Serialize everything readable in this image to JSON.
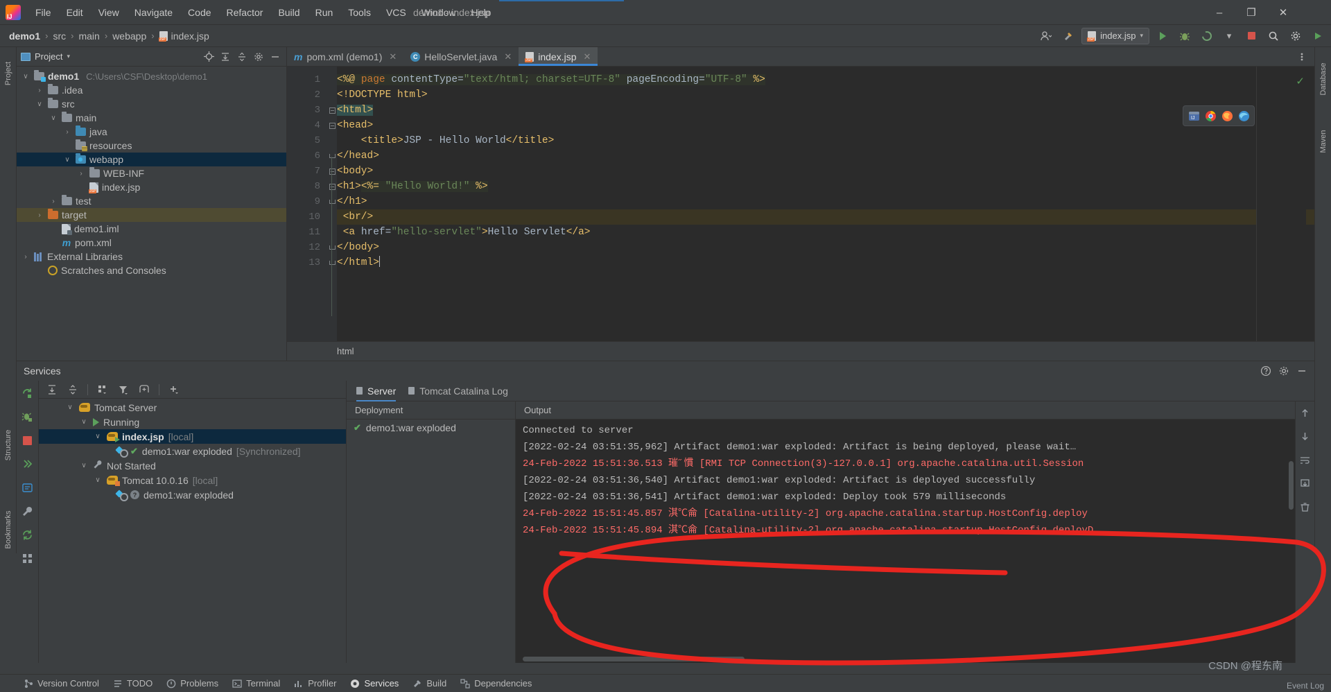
{
  "window": {
    "title": "demo1 - index.jsp",
    "logo": "intellij-idea-logo",
    "minimize": "–",
    "maximize": "❐",
    "close": "✕"
  },
  "menubar": {
    "items": [
      "File",
      "Edit",
      "View",
      "Navigate",
      "Code",
      "Refactor",
      "Build",
      "Run",
      "Tools",
      "VCS",
      "Window",
      "Help"
    ]
  },
  "navbar": {
    "breadcrumbs": [
      "demo1",
      "src",
      "main",
      "webapp",
      "index.jsp"
    ],
    "separator": "›",
    "run_config": "index.jsp",
    "run_config_caret": "▾",
    "buttons": {
      "account": "account-icon",
      "hammer": "build-icon",
      "run": "run-icon",
      "debug": "debug-icon",
      "run_with_coverage": "coverage-icon",
      "more": "▾",
      "stop": "stop-icon",
      "search": "⌕",
      "settings": "⚙",
      "updates": "updates-icon"
    }
  },
  "left_strip": {
    "labels": [
      "Project",
      "Structure",
      "Bookmarks"
    ]
  },
  "right_strip": {
    "labels": [
      "Database",
      "Maven"
    ]
  },
  "project_panel": {
    "title": "Project",
    "caret": "▾",
    "toolbar": [
      "locate-icon",
      "expand-all-icon",
      "collapse-all-icon",
      "settings-icon",
      "hide-icon"
    ],
    "more_icon": "⋮",
    "tree": [
      {
        "label": "demo1",
        "path": "C:\\Users\\CSF\\Desktop\\demo1",
        "indent": 0,
        "arrow": "∨",
        "icon": "module-folder",
        "bold": true,
        "state": "normal"
      },
      {
        "label": ".idea",
        "path": "",
        "indent": 1,
        "arrow": "›",
        "icon": "folder",
        "bold": false,
        "state": "normal"
      },
      {
        "label": "src",
        "path": "",
        "indent": 1,
        "arrow": "∨",
        "icon": "folder",
        "bold": false,
        "state": "normal"
      },
      {
        "label": "main",
        "path": "",
        "indent": 2,
        "arrow": "∨",
        "icon": "folder",
        "bold": false,
        "state": "normal"
      },
      {
        "label": "java",
        "path": "",
        "indent": 3,
        "arrow": "›",
        "icon": "folder-source",
        "bold": false,
        "state": "normal"
      },
      {
        "label": "resources",
        "path": "",
        "indent": 3,
        "arrow": "",
        "icon": "folder-resources",
        "bold": false,
        "state": "normal"
      },
      {
        "label": "webapp",
        "path": "",
        "indent": 3,
        "arrow": "∨",
        "icon": "folder-webapp",
        "bold": false,
        "state": "selected"
      },
      {
        "label": "WEB-INF",
        "path": "",
        "indent": 4,
        "arrow": "›",
        "icon": "folder",
        "bold": false,
        "state": "normal"
      },
      {
        "label": "index.jsp",
        "path": "",
        "indent": 4,
        "arrow": "",
        "icon": "jsp-file",
        "bold": false,
        "state": "normal"
      },
      {
        "label": "test",
        "path": "",
        "indent": 2,
        "arrow": "›",
        "icon": "folder",
        "bold": false,
        "state": "normal"
      },
      {
        "label": "target",
        "path": "",
        "indent": 1,
        "arrow": "›",
        "icon": "folder-target",
        "bold": false,
        "state": "highlight"
      },
      {
        "label": "demo1.iml",
        "path": "",
        "indent": 1,
        "arrow": "",
        "icon": "iml-file",
        "bold": false,
        "state": "normal"
      },
      {
        "label": "pom.xml",
        "path": "",
        "indent": 1,
        "arrow": "",
        "icon": "maven-file",
        "bold": false,
        "state": "normal"
      },
      {
        "label": "External Libraries",
        "path": "",
        "indent": 0,
        "arrow": "›",
        "icon": "libraries",
        "bold": false,
        "state": "normal"
      },
      {
        "label": "Scratches and Consoles",
        "path": "",
        "indent": 0,
        "arrow": "",
        "icon": "scratches",
        "bold": false,
        "state": "normal"
      }
    ]
  },
  "editor": {
    "tabs": [
      {
        "label": "pom.xml (demo1)",
        "icon": "maven-icon",
        "active": false,
        "close": "✕"
      },
      {
        "label": "HelloServlet.java",
        "icon": "class-icon",
        "active": false,
        "close": "✕"
      },
      {
        "label": "index.jsp",
        "icon": "jsp-icon",
        "active": true,
        "close": "✕"
      }
    ],
    "line_numbers": [
      "1",
      "2",
      "3",
      "4",
      "5",
      "6",
      "7",
      "8",
      "9",
      "10",
      "11",
      "12",
      "13"
    ],
    "code_lines": [
      "<%@ page contentType=\"text/html; charset=UTF-8\" pageEncoding=\"UTF-8\" %>",
      "<!DOCTYPE html>",
      "<html>",
      "<head>",
      "    <title>JSP - Hello World</title>",
      "</head>",
      "<body>",
      "<h1><%= \"Hello World!\" %>",
      "</h1>",
      "<br/>",
      "<a href=\"hello-servlet\">Hello Servlet</a>",
      "</body>",
      "</html>"
    ],
    "breadcrumb_status": "html",
    "inspection_status": "ok-check",
    "browser_icons": [
      "ide-browser-icon",
      "chrome-icon",
      "firefox-icon",
      "edge-icon"
    ]
  },
  "services": {
    "title": "Services",
    "head_buttons": [
      "help-icon",
      "settings-icon",
      "hide-icon"
    ],
    "side_buttons": [
      "rerun-icon",
      "debug-icon",
      "stop-icon",
      "deploy-icon",
      "connect-icon",
      "wrench-icon",
      "refresh-icon",
      "grid-icon"
    ],
    "toolbar_buttons": [
      "expand-all-icon",
      "collapse-all-icon",
      "group-icon",
      "filter-icon",
      "add-frame-icon",
      "add-icon"
    ],
    "tree": [
      {
        "label": "Tomcat Server",
        "suffix": "",
        "indent": 0,
        "arrow": "∨",
        "icon": "tomcat-icon",
        "bold": false,
        "state": "normal"
      },
      {
        "label": "Running",
        "suffix": "",
        "indent": 1,
        "arrow": "∨",
        "icon": "run-green-icon",
        "bold": false,
        "state": "normal"
      },
      {
        "label": "index.jsp",
        "suffix": "[local]",
        "indent": 2,
        "arrow": "∨",
        "icon": "tomcat-running-icon",
        "bold": true,
        "state": "selected"
      },
      {
        "label": "demo1:war exploded",
        "suffix": "[Synchronized]",
        "indent": 3,
        "arrow": "",
        "icon": "artifact-ok-icon",
        "bold": false,
        "state": "normal"
      },
      {
        "label": "Not Started",
        "suffix": "",
        "indent": 1,
        "arrow": "∨",
        "icon": "wrench-icon",
        "bold": false,
        "state": "normal"
      },
      {
        "label": "Tomcat 10.0.16",
        "suffix": "[local]",
        "indent": 2,
        "arrow": "∨",
        "icon": "tomcat-stopped-icon",
        "bold": false,
        "state": "normal"
      },
      {
        "label": "demo1:war exploded",
        "suffix": "",
        "indent": 3,
        "arrow": "",
        "icon": "artifact-unknown-icon",
        "bold": false,
        "state": "normal"
      }
    ],
    "tabs": [
      {
        "label": "Server",
        "active": true
      },
      {
        "label": "Tomcat Catalina Log",
        "active": false
      }
    ],
    "deployment": {
      "header": "Deployment",
      "rows": [
        {
          "label": "demo1:war exploded",
          "status": "deployed-check"
        }
      ]
    },
    "output": {
      "header": "Output",
      "lines": [
        {
          "text": "Connected to server",
          "color": "normal"
        },
        {
          "text": "[2022-02-24 03:51:35,962] Artifact demo1:war exploded: Artifact is being deployed, please wait…",
          "color": "normal"
        },
        {
          "text": "24-Feb-2022 15:51:36.513 璀˝慣 [RMI TCP Connection(3)-127.0.0.1] org.apache.catalina.util.Session",
          "color": "red"
        },
        {
          "text": "[2022-02-24 03:51:36,540] Artifact demo1:war exploded: Artifact is deployed successfully",
          "color": "normal"
        },
        {
          "text": "[2022-02-24 03:51:36,541] Artifact demo1:war exploded: Deploy took 579 milliseconds",
          "color": "normal"
        },
        {
          "text": "24-Feb-2022 15:51:45.857 淇℃侖 [Catalina-utility-2] org.apache.catalina.startup.HostConfig.deploy",
          "color": "red"
        },
        {
          "text": "24-Feb-2022 15:51:45.894 淇℃侖 [Catalina-utility-2] org.apache.catalina.startup.HostConfig.deployD",
          "color": "red"
        }
      ],
      "side_buttons": [
        "scroll-up-icon",
        "scroll-down-icon",
        "soft-wrap-icon",
        "scroll-end-icon",
        "trash-icon"
      ]
    }
  },
  "statusbar": {
    "items": [
      {
        "label": "Version Control",
        "icon": "branch-icon",
        "active": false
      },
      {
        "label": "TODO",
        "icon": "todo-icon",
        "active": false
      },
      {
        "label": "Problems",
        "icon": "problems-icon",
        "active": false
      },
      {
        "label": "Terminal",
        "icon": "terminal-icon",
        "active": false
      },
      {
        "label": "Profiler",
        "icon": "profiler-icon",
        "active": false
      },
      {
        "label": "Services",
        "icon": "services-icon",
        "active": true
      },
      {
        "label": "Build",
        "icon": "build-icon",
        "active": false
      },
      {
        "label": "Dependencies",
        "icon": "dependencies-icon",
        "active": false
      }
    ],
    "event_log": "Event Log"
  },
  "watermark": "CSDN @程东南",
  "annotation": {
    "type": "red-ellipse-freehand",
    "color": "#e8251f"
  },
  "colors": {
    "background": "#3c3f41",
    "editor_bg": "#2b2b2b",
    "selection": "#0d293e",
    "accent": "#3b87d6",
    "tag": "#e8bf6a",
    "string": "#6a8759",
    "keyword": "#cc7832",
    "error_red": "#ff6b68"
  }
}
